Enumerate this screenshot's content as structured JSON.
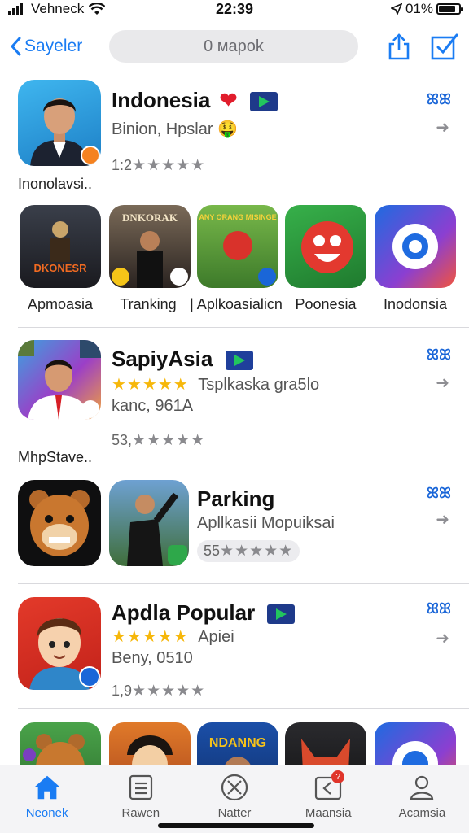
{
  "status": {
    "carrier": "Vehneck",
    "time": "22:39",
    "battery": "01%"
  },
  "nav": {
    "back_label": "Sayeler",
    "search_placeholder": "0 мароk"
  },
  "featured_1": {
    "title": "Indonesia",
    "heart": "❤",
    "subtitle": "Binion, Hpslar",
    "emoji": "🤑",
    "rating": "1:2",
    "stars": "★★★★★",
    "caption": "Inonolavsi..",
    "side_glyph": "ꕤꕤ",
    "side_arrow": "➜"
  },
  "grid_1": [
    {
      "label": "Apmoasia",
      "tile_text": "DKONESR"
    },
    {
      "label": "Tranking",
      "tile_text": "DNKORAK"
    },
    {
      "label": "| Aplkoasialicn",
      "tile_text": "ANY ORANG MISINGE"
    },
    {
      "label": "Poonesia",
      "tile_text": ""
    },
    {
      "label": "Inodonsia",
      "tile_text": ""
    }
  ],
  "featured_2": {
    "title": "SapiyAsia",
    "stars_gold": "★★★★★",
    "subtitle": "Tsplkaska gra5lo",
    "line2": "kanc, 961A",
    "rating": "53,",
    "stars": "★★★★★",
    "caption": "MhpStave..",
    "side_glyph": "ꕤꕤ",
    "side_arrow": "➜"
  },
  "featured_3": {
    "title": "Parking",
    "subtitle": "Apllkasii Mopuiksai",
    "rating": "55",
    "stars": "★★★★★",
    "side_glyph": "ꕤꕤ",
    "side_arrow": "➜"
  },
  "featured_4": {
    "title": "Apdla Popular",
    "stars_gold": "★★★★★",
    "subtitle": "Apiei",
    "line2": "Beny, 0510",
    "rating": "1,9",
    "stars": "★★★★★",
    "side_glyph": "ꕤꕤ",
    "side_arrow": "➜"
  },
  "grid_2": [
    {
      "tile_text": ""
    },
    {
      "tile_text": ""
    },
    {
      "tile_text": "NDANNG"
    },
    {
      "tile_text": ""
    },
    {
      "tile_text": ""
    }
  ],
  "tabs": [
    {
      "label": "Neonek",
      "icon": "home-icon",
      "active": true
    },
    {
      "label": "Rawen",
      "icon": "list-icon"
    },
    {
      "label": "Natter",
      "icon": "compass-icon"
    },
    {
      "label": "Maansia",
      "icon": "inbox-icon",
      "badge": "?"
    },
    {
      "label": "Acamsia",
      "icon": "person-icon"
    }
  ],
  "colors": {
    "accent": "#1a7cf3",
    "star": "#f6b70a",
    "background": "#ffffff"
  }
}
